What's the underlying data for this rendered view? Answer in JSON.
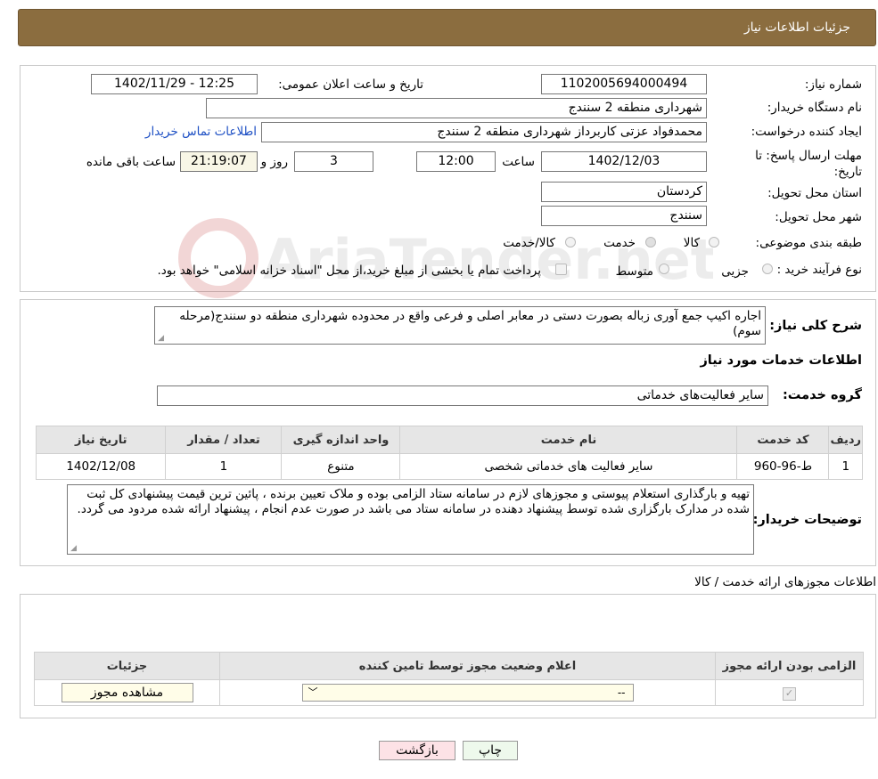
{
  "header": {
    "title": "جزئیات اطلاعات نیاز"
  },
  "form": {
    "need_number": {
      "label": "شماره نیاز:",
      "value": "1102005694000494"
    },
    "announce_datetime": {
      "label": "تاریخ و ساعت اعلان عمومی:",
      "value": "1402/11/29 - 12:25"
    },
    "buyer_org": {
      "label": "نام دستگاه خریدار:",
      "value": "شهرداری منطقه 2 سنندج"
    },
    "requester": {
      "label": "ایجاد کننده درخواست:",
      "value": "محمدفواد عزتی کاربرداز شهرداری منطقه 2 سنندج"
    },
    "buyer_contact_link": "اطلاعات تماس خریدار",
    "deadline": {
      "label": "مهلت ارسال پاسخ: تا تاریخ:",
      "date": "1402/12/03",
      "time_label": "ساعت",
      "time": "12:00",
      "days": "3",
      "days_label": "روز و",
      "remaining": "21:19:07",
      "remaining_label": "ساعت باقی مانده"
    },
    "province": {
      "label": "استان محل تحویل:",
      "value": "کردستان"
    },
    "city": {
      "label": "شهر محل تحویل:",
      "value": "سنندج"
    },
    "category": {
      "label": "طبقه بندی موضوعی:",
      "options": [
        "کالا",
        "خدمت",
        "کالا/خدمت"
      ],
      "selected": "خدمت"
    },
    "purchase_type": {
      "label": "نوع فرآیند خرید :",
      "options": [
        "جزیی",
        "متوسط"
      ],
      "payment_note": "پرداخت تمام یا بخشی از مبلغ خرید،از محل \"اسناد خزانه اسلامی\" خواهد بود."
    }
  },
  "description": {
    "label": "شرح کلی نیاز:",
    "value": "اجاره اکیپ جمع آوری زباله بصورت دستی در معابر اصلی و فرعی واقع در محدوده شهرداری منطقه دو سنندج(مرحله سوم)"
  },
  "services": {
    "section_title": "اطلاعات خدمات مورد نیاز",
    "group_label": "گروه خدمت:",
    "group_value": "سایر فعالیت‌های خدماتی",
    "table": {
      "headers": [
        "ردیف",
        "کد خدمت",
        "نام خدمت",
        "واحد اندازه گیری",
        "تعداد / مقدار",
        "تاریخ نیاز"
      ],
      "rows": [
        [
          "1",
          "ط-96-960",
          "سایر فعالیت های خدماتی شخصی",
          "متنوع",
          "1",
          "1402/12/08"
        ]
      ]
    }
  },
  "buyer_notes": {
    "label": "توضیحات خریدار:",
    "value": "تهیه و بارگذاری استعلام پیوستی و مجوزهای لازم در سامانه ستاد الزامی بوده و ملاک تعیین برنده ، پائین ترین قیمت پیشنهادی کل ثبت شده در مدارک بارگزاری شده توسط پیشنهاد دهنده در سامانه ستاد می باشد در صورت عدم انجام ، پیشنهاد ارائه شده مردود می گردد."
  },
  "permits": {
    "section_title": "اطلاعات مجوزهای ارائه خدمت / کالا",
    "table": {
      "headers": [
        "الزامی بودن ارائه مجوز",
        "اعلام وضعیت مجوز توسط تامین کننده",
        "جزئیات"
      ],
      "row": {
        "required_checked": true,
        "status_value": "--",
        "details_button": "مشاهده مجوز"
      }
    }
  },
  "actions": {
    "print": "چاپ",
    "back": "بازگشت"
  },
  "watermark": "AriaTender.net"
}
